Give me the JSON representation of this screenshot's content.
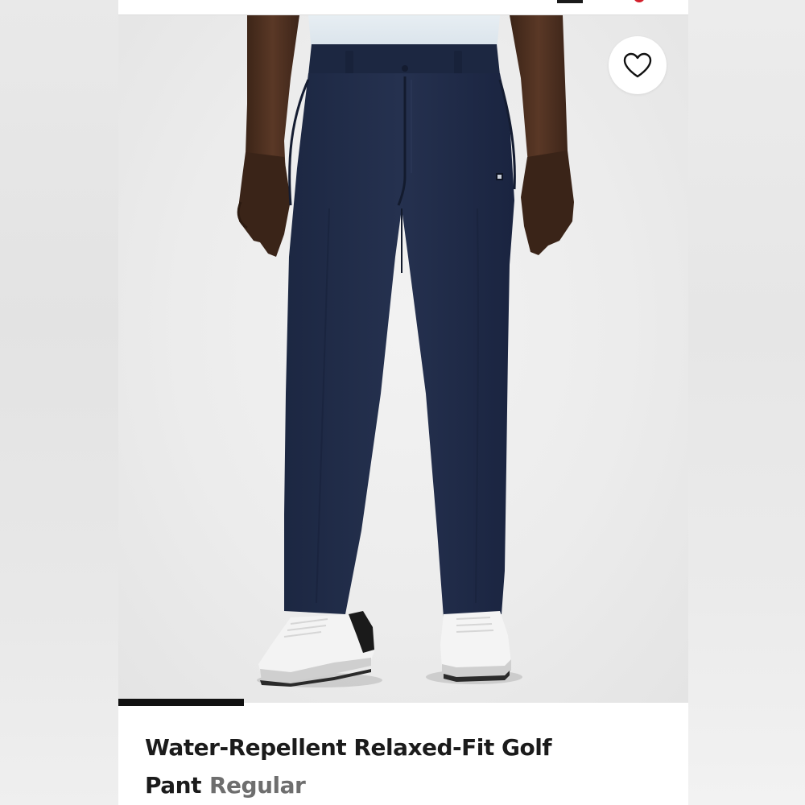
{
  "product": {
    "title_line1": "Water-Repellent Relaxed-Fit Golf",
    "title_line2": "Pant",
    "fit": "Regular",
    "image_alt": "Navy water-repellent relaxed-fit golf pant worn with white golf shoes"
  },
  "icons": {
    "favorite": "heart-outline-icon",
    "menu": "menu-icon",
    "bag_badge": "bag-badge-icon"
  },
  "colors": {
    "pant": "#1f2a45",
    "accent": "#d31f2b",
    "indicator": "#111111"
  },
  "carousel": {
    "current_index": 1,
    "indicator_fraction": 0.22
  }
}
